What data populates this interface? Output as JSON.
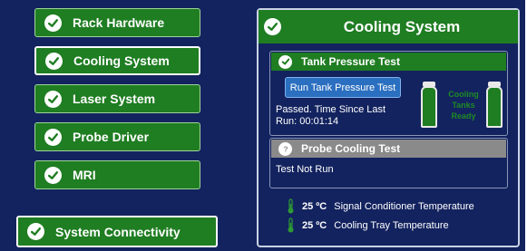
{
  "colors": {
    "background": "#13235f",
    "success_green": "#1f7d22",
    "gray_header": "#8a8a8a",
    "button_blue": "#2b6fc0"
  },
  "nav": {
    "items": [
      {
        "label": "Rack Hardware",
        "icon": "check-circle-icon",
        "selected": false
      },
      {
        "label": "Cooling System",
        "icon": "check-circle-icon",
        "selected": true
      },
      {
        "label": "Laser System",
        "icon": "check-circle-icon",
        "selected": false
      },
      {
        "label": "Probe Driver",
        "icon": "check-circle-icon",
        "selected": false
      },
      {
        "label": "MRI",
        "icon": "check-circle-icon",
        "selected": false
      }
    ],
    "connectivity": {
      "label": "System Connectivity",
      "icon": "check-circle-icon"
    }
  },
  "panel": {
    "title": "Cooling System",
    "title_icon": "check-circle-icon",
    "tank_pressure": {
      "title": "Tank Pressure Test",
      "icon": "check-circle-icon",
      "run_button": "Run Tank Pressure Test",
      "status_line1": "Passed. Time Since Last",
      "status_line2": "Run: 00:01:14",
      "tanks_label_line1": "Cooling",
      "tanks_label_line2": "Tanks",
      "tanks_label_line3": "Ready"
    },
    "probe_cooling": {
      "title": "Probe Cooling Test",
      "icon": "question-circle-icon",
      "status": "Test Not Run"
    },
    "temperatures": [
      {
        "value": "25 ºC",
        "label": "Signal Conditioner Temperature",
        "icon": "thermometer-icon"
      },
      {
        "value": "25 ºC",
        "label": "Cooling Tray Temperature",
        "icon": "thermometer-icon"
      }
    ]
  }
}
